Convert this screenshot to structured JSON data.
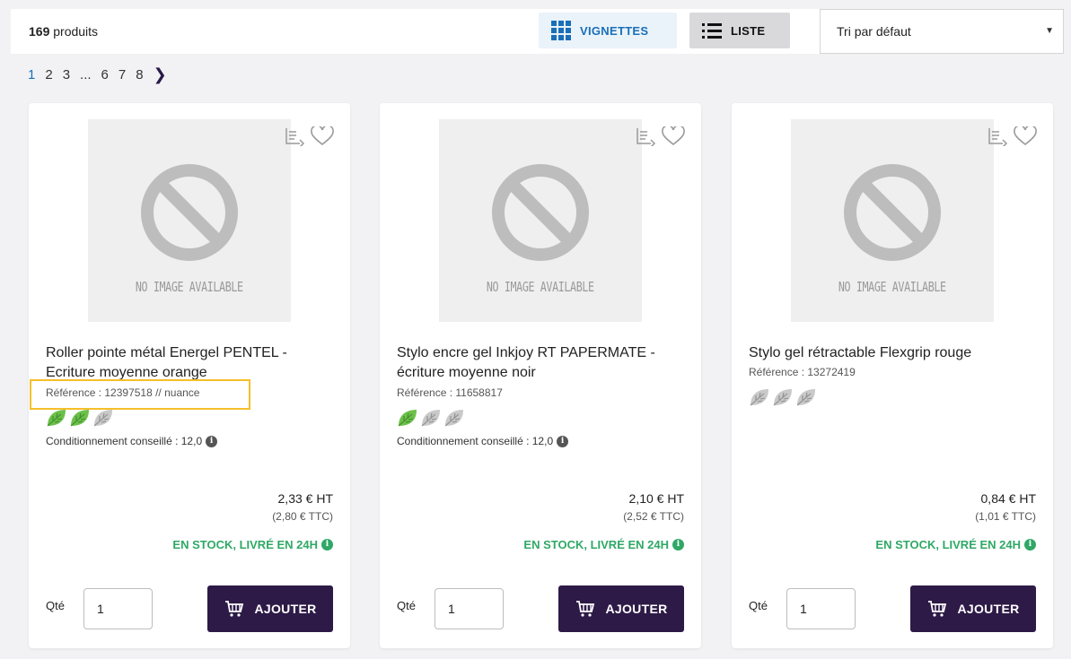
{
  "header": {
    "count_number": "169",
    "count_label": "produits",
    "view_grid_label": "VIGNETTES",
    "view_list_label": "LISTE",
    "sort_value": "Tri par défaut"
  },
  "pagination": [
    "1",
    "2",
    "3",
    "...",
    "6",
    "7",
    "8"
  ],
  "products": [
    {
      "title_line1": "Roller pointe métal Energel PENTEL -",
      "title_line2": "Ecriture moyenne orange",
      "reference": "Référence : 12397518 // nuance",
      "eco_leaves_active": 2,
      "conditioning": "Conditionnement conseillé : 12,0",
      "price_ht": "2,33 € HT",
      "price_ttc": "(2,80 € TTC)",
      "stock": "EN STOCK, LIVRÉ EN 24H",
      "qty_label": "Qté",
      "qty_value": "1",
      "add_label": "AJOUTER"
    },
    {
      "title_line1": "Stylo encre gel Inkjoy RT PAPERMATE -",
      "title_line2": "écriture moyenne noir",
      "reference": "Référence : 11658817",
      "eco_leaves_active": 1,
      "conditioning": "Conditionnement conseillé : 12,0",
      "price_ht": "2,10 € HT",
      "price_ttc": "(2,52 € TTC)",
      "stock": "EN STOCK, LIVRÉ EN 24H",
      "qty_label": "Qté",
      "qty_value": "1",
      "add_label": "AJOUTER"
    },
    {
      "title_line1": "Stylo gel rétractable Flexgrip rouge",
      "title_line2": "",
      "reference": "Référence : 13272419",
      "eco_leaves_active": 0,
      "conditioning": "",
      "price_ht": "0,84 € HT",
      "price_ttc": "(1,01 € TTC)",
      "stock": "EN STOCK, LIVRÉ EN 24H",
      "qty_label": "Qté",
      "qty_value": "1",
      "add_label": "AJOUTER"
    }
  ],
  "no_image_text": "NO IMAGE AVAILABLE",
  "colors": {
    "accent_blue": "#1a6fb8",
    "stock_green": "#2fa866",
    "button_purple": "#2d1a47",
    "highlight_yellow": "#f5bf2a"
  }
}
